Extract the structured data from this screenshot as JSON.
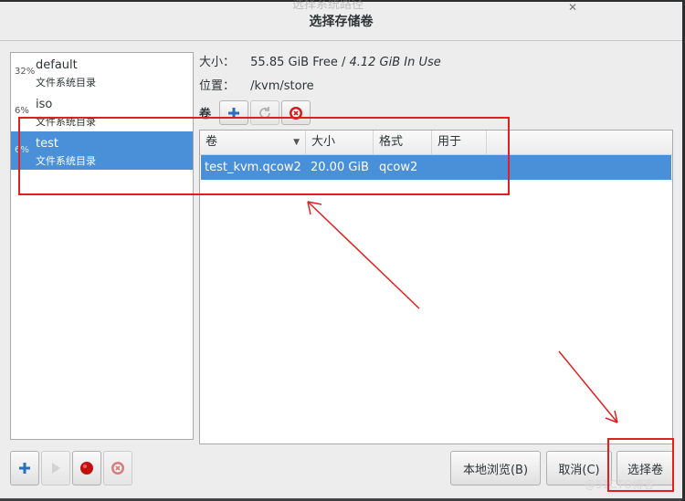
{
  "window": {
    "title": "选择存储卷",
    "ghost_title": "选择系统路径"
  },
  "pools": [
    {
      "pct": "32%",
      "name": "default",
      "type": "文件系统目录",
      "selected": false
    },
    {
      "pct": "6%",
      "name": "iso",
      "type": "文件系统目录",
      "selected": false
    },
    {
      "pct": "6%",
      "name": "test",
      "type": "文件系统目录",
      "selected": true
    }
  ],
  "info": {
    "size_label": "大小：",
    "size_free": "55.85 GiB Free /",
    "size_in_use": "4.12 GiB In Use",
    "location_label": "位置：",
    "location_value": "/kvm/store"
  },
  "volumes": {
    "label": "卷",
    "columns": [
      "卷",
      "大小",
      "格式",
      "用于"
    ],
    "rows": [
      {
        "name": "test_kvm.qcow2",
        "size": "20.00 GiB",
        "format": "qcow2",
        "used_by": ""
      }
    ]
  },
  "toolbar": {
    "add_icon": "plus-icon",
    "refresh_icon": "refresh-icon",
    "delete_icon": "delete-icon"
  },
  "bottom": {
    "browse_local": "本地浏览(B)",
    "cancel": "取消(C)",
    "choose_volume": "选择卷"
  },
  "pool_controls": [
    "plus-icon",
    "play-icon",
    "stop-icon",
    "delete-icon"
  ],
  "watermark": "@51CTO博客",
  "colors": {
    "selection": "#4a90d9",
    "annotation": "#e02020"
  }
}
